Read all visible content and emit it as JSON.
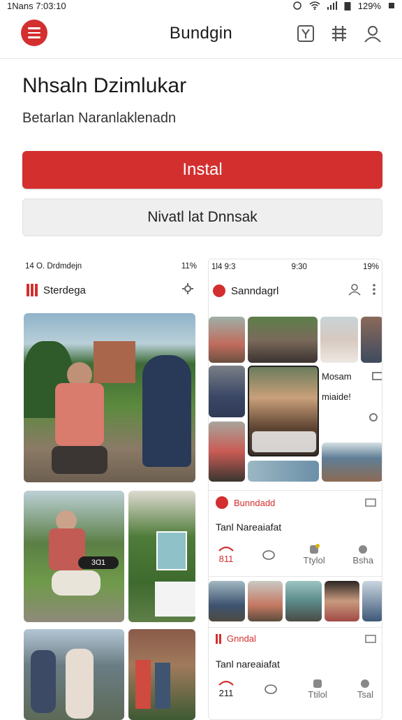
{
  "status": {
    "time": "1Nans 7:03:10",
    "battery": "129%"
  },
  "header": {
    "title": "Bundgin"
  },
  "intro": {
    "title": "Nhsaln Dzimlukar",
    "subtitle": "Betarlan Naranlaklenadn"
  },
  "actions": {
    "install_label": "Instal",
    "secondary_label": "Nivatl lat Dnnsak"
  },
  "shot1": {
    "status_left": "14 O. Drdmdejn",
    "status_right": "11%",
    "app_name": "Sterdega",
    "badge": "3Ɑ1"
  },
  "shot2": {
    "status_left": "1l4 9:3",
    "status_mid": "9:30",
    "status_right": "19%",
    "app_name": "Sanndagrl",
    "side_card": {
      "line1": "Mosam",
      "line2": "miaide!"
    },
    "post1": {
      "author": "Bunndadd",
      "text": "Tanl Nareaiafat",
      "stat1": "811",
      "stat3": "Ttylol",
      "stat4": "Bsha"
    },
    "post2": {
      "author": "Gnndal",
      "text": "Tanl nareaiafat",
      "stat1": "211",
      "stat3": "Ttilol",
      "stat4": "Tsal"
    }
  },
  "colors": {
    "accent": "#d32f2f"
  }
}
